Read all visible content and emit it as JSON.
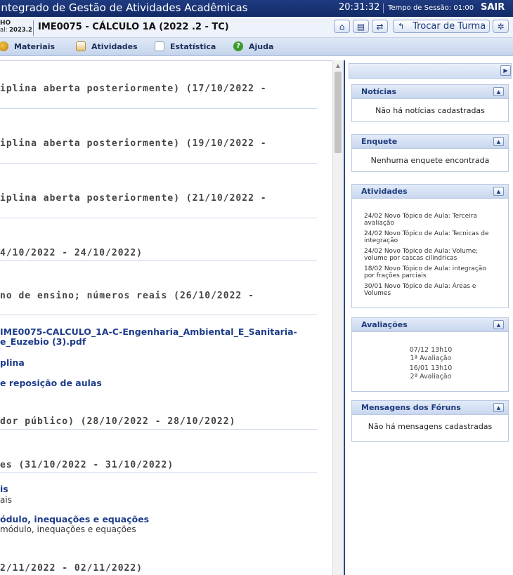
{
  "topbar": {
    "system_title": "Integrado de Gestão de Atividades Acadêmicas",
    "clock": "20:31:32",
    "session_label": "Tempo de Sessão: 01:00",
    "logout": "SAIR"
  },
  "header": {
    "institution_line1": "HO",
    "institution_line2_prefix": "al:",
    "institution_line2_period": "2023.2",
    "course_title": "IME0075 - CÁLCULO 1A (2022 .2 - TC)",
    "switch_class_label": "Trocar de Turma"
  },
  "menu": {
    "items": [
      "Materiais",
      "Atividades",
      "Estatística",
      "Ajuda"
    ]
  },
  "main": {
    "topics": [
      "iplina aberta posteriormente) (17/10/2022 -",
      "iplina aberta posteriormente) (19/10/2022 -",
      "iplina aberta posteriormente) (21/10/2022 -",
      "4/10/2022 - 24/10/2022)",
      "no de ensino; números reais (26/10/2022 -",
      "dor público) (28/10/2022 - 28/10/2022)",
      "es (31/10/2022 - 31/10/2022)",
      "2/11/2022 - 02/11/2022)"
    ],
    "links": {
      "file_line1": "IME0075-CALCULO_1A-C-Engenharia_Ambiental_E_Sanitaria-",
      "file_line2": "e_Euzebio (3).pdf",
      "plina": "plina",
      "reposicao": "e reposição de aulas",
      "is_link": "is",
      "is_sub": "ais",
      "modulo_link": "ódulo, inequações e equações",
      "modulo_sub": "módulo, inequações e equações"
    }
  },
  "sidebar": {
    "noticias": {
      "title": "Notícias",
      "empty": "Não há notícias cadastradas"
    },
    "enquete": {
      "title": "Enquete",
      "empty": "Nenhuma enquete encontrada"
    },
    "atividades": {
      "title": "Atividades",
      "items": [
        {
          "date": "24/02",
          "text": "Novo Tópico de Aula: Terceira avaliação"
        },
        {
          "date": "24/02",
          "text": "Novo Tópico de Aula: Tecnicas de integração"
        },
        {
          "date": "24/02",
          "text": "Novo Tópico de Aula: Volume; volume por cascas cilindricas"
        },
        {
          "date": "18/02",
          "text": "Novo Tópico de Aula: integração por frações parciais"
        },
        {
          "date": "30/01",
          "text": "Novo Tópico de Aula: Áreas e Volumes"
        }
      ]
    },
    "avaliacoes": {
      "title": "Avaliações",
      "items": [
        {
          "date": "07/12 13h10",
          "name": "1ª Avaliação"
        },
        {
          "date": "16/01 13h10",
          "name": "2ª Avaliação"
        }
      ]
    },
    "foruns": {
      "title": "Mensagens dos Fóruns",
      "empty": "Não há mensagens cadastradas"
    }
  }
}
